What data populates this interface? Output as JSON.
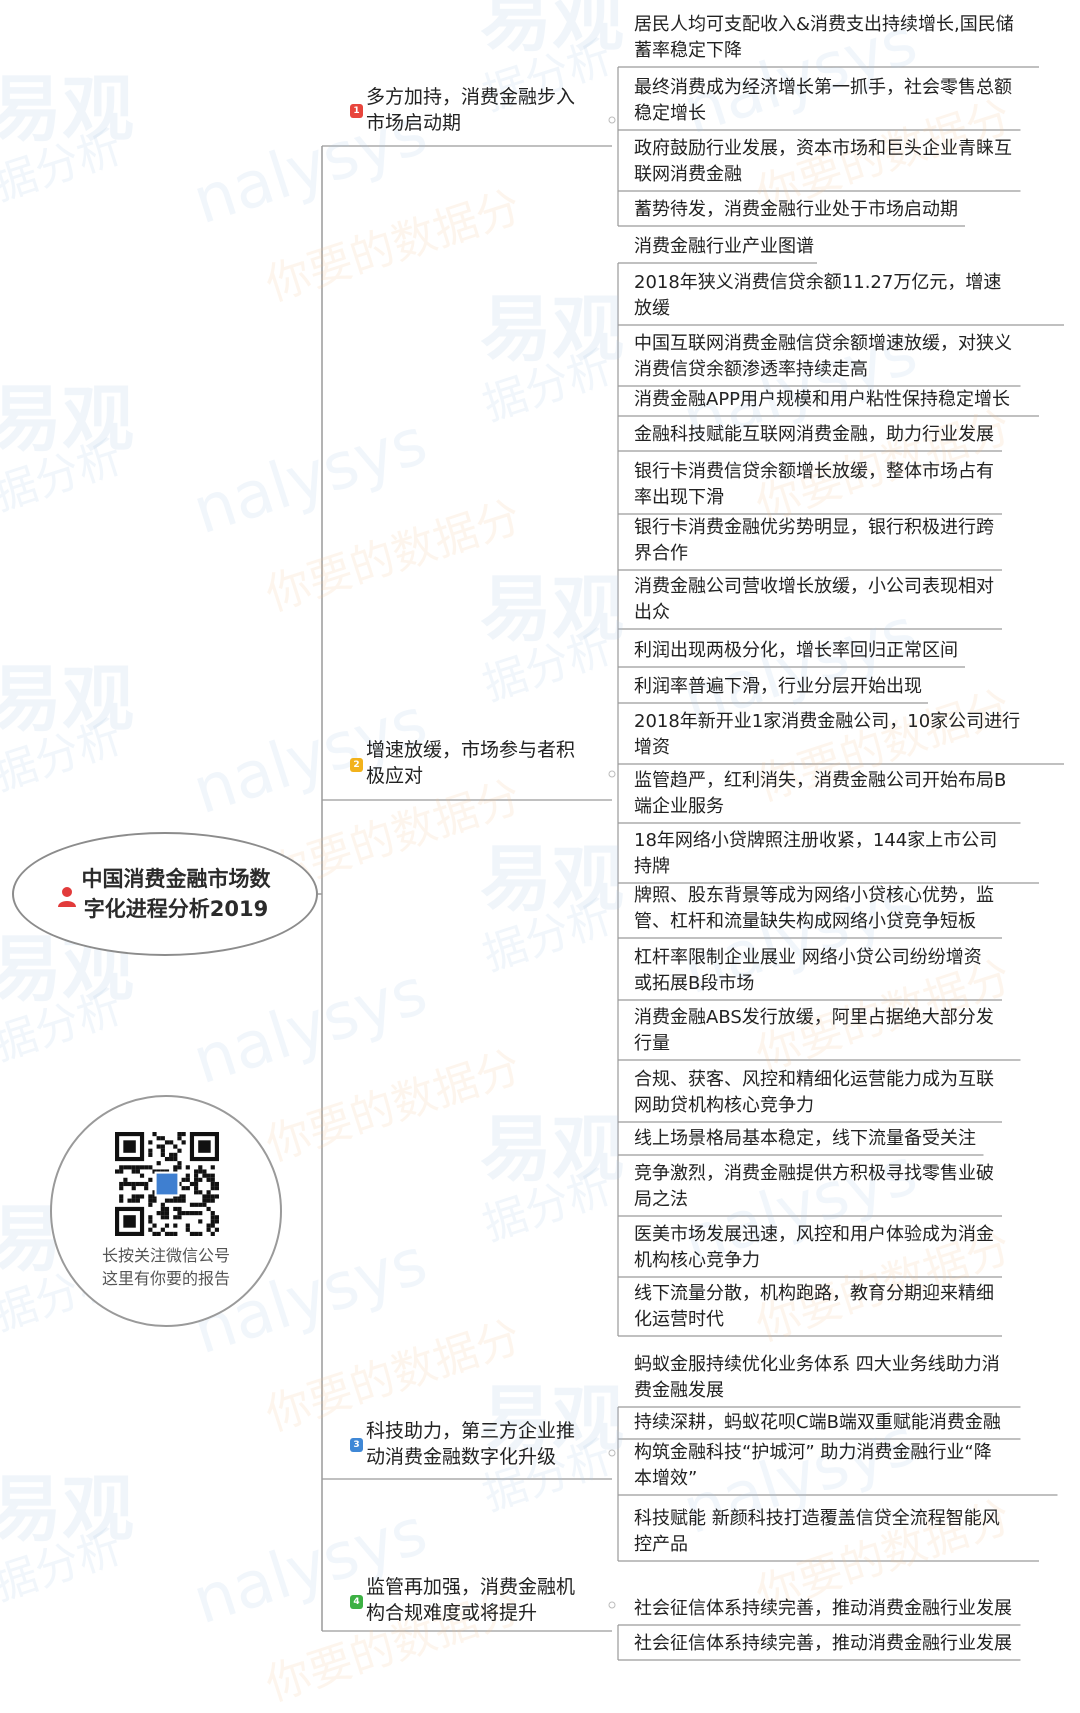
{
  "root": {
    "title_line1": "中国消费金融市场数",
    "title_line2": "字化进程分析2019"
  },
  "qr": {
    "caption_line1": "长按关注微信公号",
    "caption_line2": "这里有你要的报告"
  },
  "watermark": {
    "cn": "易观",
    "cn2": "据分析",
    "en": "nalysys",
    "cn3": "你要的数据分"
  },
  "branches": [
    {
      "num": "1",
      "color": "#e8453c",
      "line1": "多方加持，消费金融步入",
      "line2": "市场启动期"
    },
    {
      "num": "2",
      "color": "#f2b21b",
      "line1": "增速放缓，市场参与者积",
      "line2": "极应对"
    },
    {
      "num": "3",
      "color": "#3f88d6",
      "line1": "科技助力，第三方企业推",
      "line2": "动消费金融数字化升级"
    },
    {
      "num": "4",
      "color": "#3cb043",
      "line1": "监管再加强，消费金融机",
      "line2": "构合规难度或将提升"
    }
  ],
  "leaves": [
    {
      "l1": "居民人均可支配收入&消费支出持续增长,国民储",
      "l2": "蓄率稳定下降"
    },
    {
      "l1": "最终消费成为经济增长第一抓手，社会零售总额",
      "l2": "稳定增长"
    },
    {
      "l1": "政府鼓励行业发展，资本市场和巨头企业青睐互",
      "l2": "联网消费金融"
    },
    {
      "l1": "蓄势待发，消费金融行业处于市场启动期",
      "l2": ""
    },
    {
      "l1": "消费金融行业产业图谱",
      "l2": ""
    },
    {
      "l1": "2018年狭义消费信贷余额11.27万亿元，增速",
      "l2": "放缓"
    },
    {
      "l1": "中国互联网消费金融信贷余额增速放缓，对狭义",
      "l2": "消费信贷余额渗透率持续走高"
    },
    {
      "l1": "消费金融APP用户规模和用户粘性保持稳定增长",
      "l2": ""
    },
    {
      "l1": "金融科技赋能互联网消费金融，助力行业发展",
      "l2": ""
    },
    {
      "l1": "银行卡消费信贷余额增长放缓，整体市场占有",
      "l2": "率出现下滑"
    },
    {
      "l1": "银行卡消费金融优劣势明显，银行积极进行跨",
      "l2": "界合作"
    },
    {
      "l1": "消费金融公司营收增长放缓，小公司表现相对",
      "l2": "出众"
    },
    {
      "l1": "利润出现两极分化，增长率回归正常区间",
      "l2": ""
    },
    {
      "l1": "利润率普遍下滑，行业分层开始出现",
      "l2": ""
    },
    {
      "l1": "2018年新开业1家消费金融公司，10家公司进行",
      "l2": "增资"
    },
    {
      "l1": "监管趋严，红利消失，消费金融公司开始布局B",
      "l2": "端企业服务"
    },
    {
      "l1": "18年网络小贷牌照注册收紧，144家上市公司",
      "l2": "持牌"
    },
    {
      "l1": "牌照、股东背景等成为网络小贷核心优势，监",
      "l2": "管、杠杆和流量缺失构成网络小贷竞争短板"
    },
    {
      "l1": "杠杆率限制企业展业 网络小贷公司纷纷增资",
      "l2": "或拓展B段市场"
    },
    {
      "l1": "消费金融ABS发行放缓，阿里占据绝大部分发",
      "l2": "行量"
    },
    {
      "l1": "合规、获客、风控和精细化运营能力成为互联",
      "l2": "网助贷机构核心竞争力"
    },
    {
      "l1": "线上场景格局基本稳定，线下流量备受关注",
      "l2": ""
    },
    {
      "l1": "竞争激烈，消费金融提供方积极寻找零售业破",
      "l2": "局之法"
    },
    {
      "l1": "医美市场发展迅速，风控和用户体验成为消金",
      "l2": "机构核心竞争力"
    },
    {
      "l1": "线下流量分散，机构跑路，教育分期迎来精细",
      "l2": "化运营时代"
    },
    {
      "l1": "蚂蚁金服持续优化业务体系 四大业务线助力消",
      "l2": "费金融发展"
    },
    {
      "l1": "持续深耕，蚂蚁花呗C端B端双重赋能消费金融",
      "l2": ""
    },
    {
      "l1": "构筑金融科技“护城河”  助力消费金融行业“降",
      "l2": "本增效”"
    },
    {
      "l1": "科技赋能  新颜科技打造覆盖信贷全流程智能风",
      "l2": "控产品"
    },
    {
      "l1": "社会征信体系持续完善，推动消费金融行业发展",
      "l2": ""
    },
    {
      "l1": "社会征信体系持续完善，推动消费金融行业发展",
      "l2": ""
    }
  ]
}
